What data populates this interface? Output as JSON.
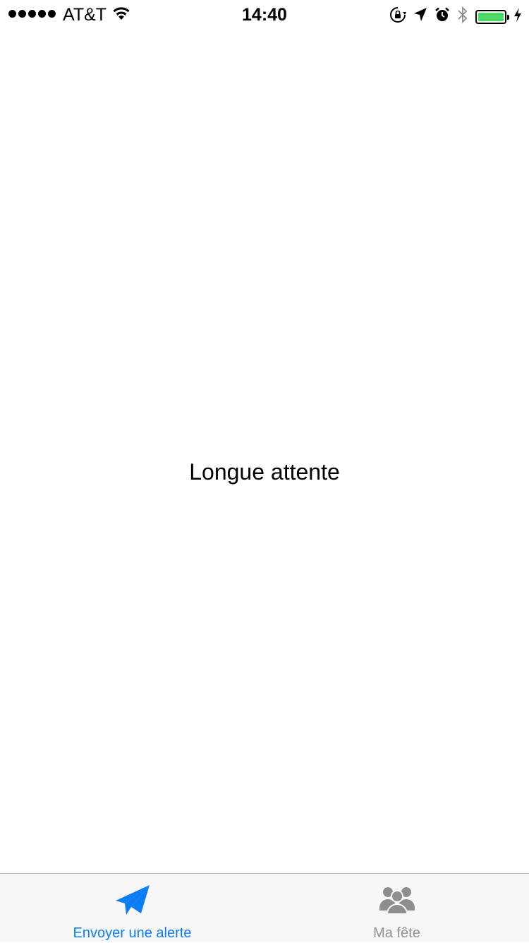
{
  "status_bar": {
    "carrier": "AT&T",
    "time": "14:40",
    "signal_bars": 5,
    "battery_level": 1.0,
    "battery_color": "#4cd964",
    "icons": [
      "wifi-icon",
      "orientation-lock-icon",
      "location-arrow-icon",
      "alarm-icon",
      "bluetooth-icon",
      "battery-icon",
      "charging-bolt-icon"
    ]
  },
  "main": {
    "label": "Longue attente"
  },
  "tab_bar": {
    "tabs": [
      {
        "label": "Envoyer une alerte",
        "icon": "paper-plane-icon",
        "active": true,
        "color": "#0a7cf5"
      },
      {
        "label": "Ma fête",
        "icon": "group-icon",
        "active": false,
        "color": "#929292"
      }
    ]
  }
}
